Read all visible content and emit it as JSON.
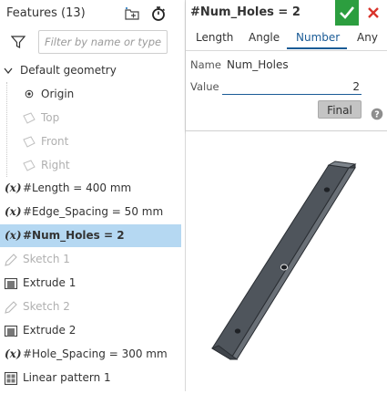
{
  "features_panel": {
    "title": "Features (13)",
    "filter_placeholder": "Filter by name or type",
    "items": [
      {
        "label": "Default geometry",
        "kind": "group"
      },
      {
        "label": "Origin",
        "kind": "origin"
      },
      {
        "label": "Top",
        "kind": "plane"
      },
      {
        "label": "Front",
        "kind": "plane"
      },
      {
        "label": "Right",
        "kind": "plane"
      },
      {
        "label": "#Length = 400 mm",
        "kind": "variable"
      },
      {
        "label": "#Edge_Spacing = 50 mm",
        "kind": "variable"
      },
      {
        "label": "#Num_Holes = 2",
        "kind": "variable",
        "selected": true
      },
      {
        "label": "Sketch 1",
        "kind": "sketch"
      },
      {
        "label": "Extrude 1",
        "kind": "extrude"
      },
      {
        "label": "Sketch 2",
        "kind": "sketch"
      },
      {
        "label": "Extrude 2",
        "kind": "extrude"
      },
      {
        "label": "#Hole_Spacing = 300 mm",
        "kind": "variable"
      },
      {
        "label": "Linear pattern 1",
        "kind": "pattern"
      }
    ],
    "variable_symbol": "(x)"
  },
  "dialog": {
    "title": "#Num_Holes = 2",
    "tabs": [
      "Length",
      "Angle",
      "Number",
      "Any"
    ],
    "active_tab": "Number",
    "name_label": "Name",
    "name_value": "Num_Holes",
    "value_label": "Value",
    "value": "2",
    "final_label": "Final"
  },
  "colors": {
    "accept": "#2c9e3f",
    "cancel": "#d9342b",
    "selection": "#b5d8f2",
    "accent": "#1a5b96",
    "part": "#5a6068"
  }
}
